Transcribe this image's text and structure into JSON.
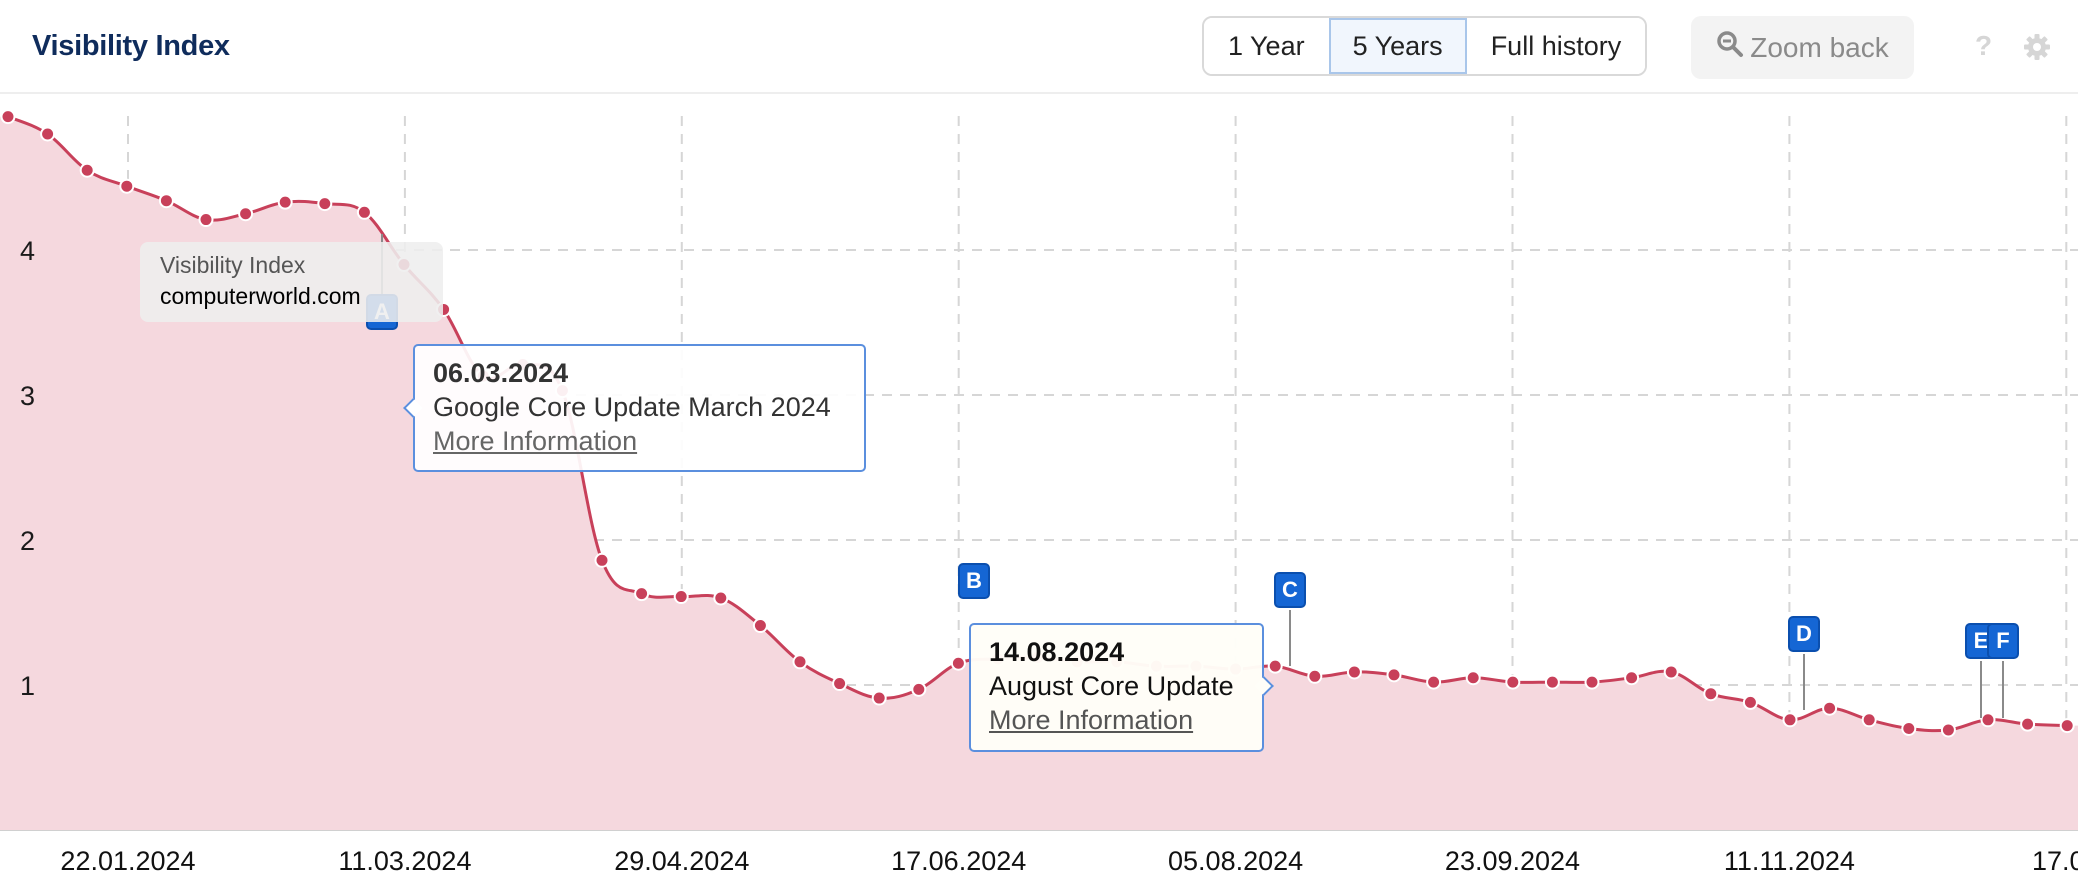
{
  "header": {
    "title": "Visibility Index",
    "range_buttons": [
      {
        "label": "1 Year",
        "active": false
      },
      {
        "label": "5 Years",
        "active": true
      },
      {
        "label": "Full history",
        "active": false
      }
    ],
    "zoom_back_label": "Zoom back",
    "help_label": "?"
  },
  "series_tooltip": {
    "metric": "Visibility Index",
    "domain": "computerworld.com"
  },
  "events": [
    {
      "flag": "A",
      "date": "06.03.2024",
      "name": "Google Core Update March 2024",
      "link": "More Information"
    },
    {
      "flag": "B"
    },
    {
      "flag": "C",
      "date": "14.08.2024",
      "name": "August Core Update",
      "link": "More Information"
    },
    {
      "flag": "D"
    },
    {
      "flag": "E"
    },
    {
      "flag": "F"
    }
  ],
  "colors": {
    "line": "#c8405a",
    "area": "#f5d8de",
    "flag": "#1566d4",
    "title": "#0f2c5c"
  },
  "chart_data": {
    "type": "area",
    "title": "Visibility Index",
    "series_name": "computerworld.com",
    "xlabel": "",
    "ylabel": "",
    "ylim": [
      0,
      4.8
    ],
    "yticks": [
      1,
      2,
      3,
      4
    ],
    "xtick_labels": [
      "22.01.2024",
      "11.03.2024",
      "29.04.2024",
      "17.06.2024",
      "05.08.2024",
      "23.09.2024",
      "11.11.2024",
      "17.0"
    ],
    "grid": true,
    "frequency": "weekly",
    "values": [
      4.92,
      4.8,
      4.55,
      4.44,
      4.34,
      4.21,
      4.25,
      4.33,
      4.32,
      4.26,
      3.9,
      3.59,
      3.13,
      3.21,
      3.03,
      1.86,
      1.63,
      1.61,
      1.6,
      1.41,
      1.16,
      1.01,
      0.91,
      0.97,
      1.15,
      1.18,
      1.19,
      1.16,
      1.16,
      1.13,
      1.13,
      1.11,
      1.13,
      1.06,
      1.09,
      1.07,
      1.02,
      1.05,
      1.02,
      1.02,
      1.02,
      1.05,
      1.09,
      0.94,
      0.88,
      0.76,
      0.84,
      0.76,
      0.7,
      0.69,
      0.76,
      0.73,
      0.72
    ],
    "event_markers": [
      {
        "flag": "A",
        "point_index": 9
      },
      {
        "flag": "B",
        "point_index": 24
      },
      {
        "flag": "C",
        "point_index": 33
      },
      {
        "flag": "D",
        "point_index": 45
      },
      {
        "flag": "E",
        "point_index": 50
      },
      {
        "flag": "F",
        "point_index": 51
      }
    ]
  }
}
